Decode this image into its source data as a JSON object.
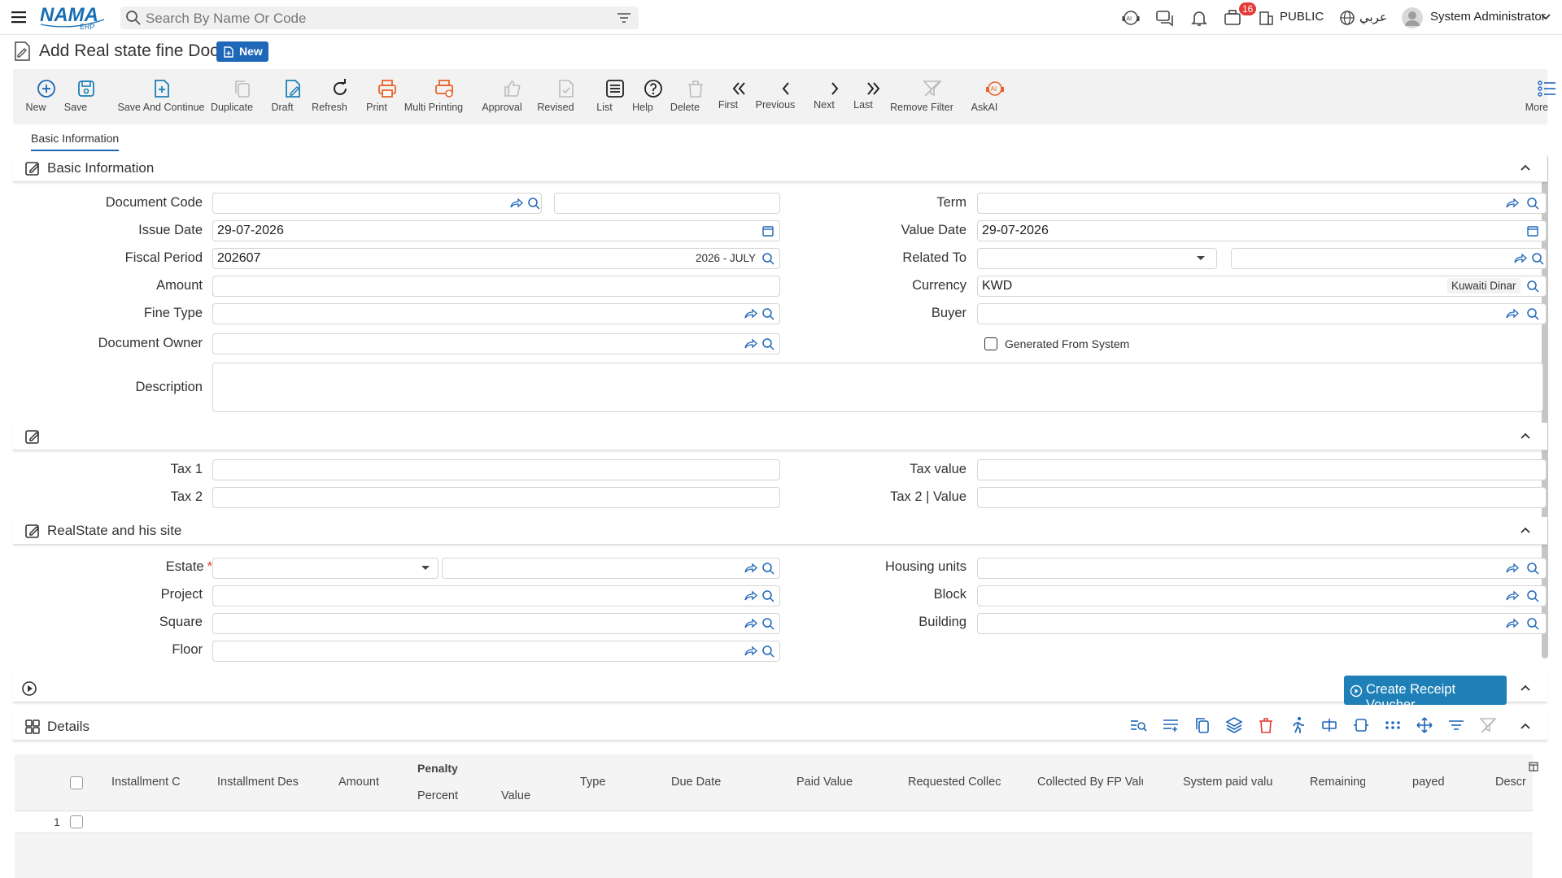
{
  "header": {
    "search_placeholder": "Search By Name Or Code",
    "notification_count": "16",
    "org": "PUBLIC",
    "language": "عربي",
    "user": "System Administrator"
  },
  "page": {
    "title": "Add Real state fine Doc",
    "status_badge": "New"
  },
  "toolbar": [
    "New",
    "Save",
    "Save And Continue",
    "Duplicate",
    "Draft",
    "Refresh",
    "Print",
    "Multi Printing",
    "Approval",
    "Revised",
    "List",
    "Help",
    "Delete",
    "First",
    "Previous",
    "Next",
    "Last",
    "Remove Filter",
    "AskAI",
    "More"
  ],
  "tabs": {
    "basic": "Basic Information"
  },
  "section1": {
    "title": "Basic Information",
    "document_code": "Document Code",
    "issue_date": "Issue Date",
    "issue_date_value": "29-07-2026",
    "fiscal_period": "Fiscal Period",
    "fiscal_period_value": "202607",
    "fiscal_period_desc": "2026 - JULY",
    "amount": "Amount",
    "fine_type": "Fine Type",
    "document_owner": "Document Owner",
    "description": "Description",
    "term": "Term",
    "value_date": "Value Date",
    "value_date_value": "29-07-2026",
    "related_to": "Related To",
    "currency": "Currency",
    "currency_value": "KWD",
    "currency_desc": "Kuwaiti Dinar",
    "buyer": "Buyer",
    "generated": "Generated From System"
  },
  "section2": {
    "tax1": "Tax 1",
    "tax2": "Tax 2",
    "tax_value": "Tax value",
    "tax2_value": "Tax 2 | Value"
  },
  "section3": {
    "title": "RealState and his site",
    "estate": "Estate",
    "project": "Project",
    "square": "Square",
    "floor": "Floor",
    "housing_units": "Housing units",
    "block": "Block",
    "building": "Building"
  },
  "section4": {
    "create_receipt": "Create Receipt Voucher"
  },
  "details": {
    "title": "Details",
    "columns": [
      "Installment Co",
      "Installment Desc",
      "Amount",
      "Penalty",
      "Percent",
      "Value",
      "Type",
      "Due Date",
      "Paid Value",
      "Requested Collect",
      "Collected By FP Value",
      "System paid value",
      "Remaining",
      "payed",
      "Descr"
    ],
    "row_number": "1"
  }
}
